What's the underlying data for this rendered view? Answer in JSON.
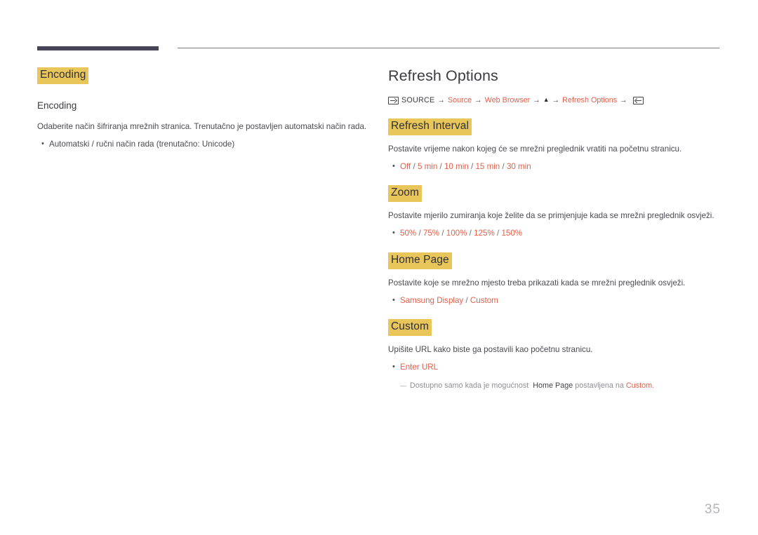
{
  "page": {
    "number": "35"
  },
  "left_column": {
    "section_heading": "Encoding",
    "sub_heading": "Encoding",
    "description": "Odaberite način šifriranja mrežnih stranica. Trenutačno je postavljen automatski način rada.",
    "bullets": [
      {
        "text": "Automatski / ručni način rada (trenutačno: Unicode)"
      }
    ]
  },
  "right_column": {
    "title": "Refresh Options",
    "breadcrumb": {
      "source_icon": "source-input-icon",
      "source_label": "SOURCE",
      "arrow": "→",
      "item1": "Source",
      "item2": "Web Browser",
      "triangle": "▲",
      "item3": "Refresh Options",
      "enter_icon": "enter-key-icon"
    },
    "sections": [
      {
        "heading": "Refresh Interval",
        "description": "Postavite vrijeme nakon kojeg će se mrežni preglednik vratiti na početnu stranicu.",
        "options": [
          "Off",
          "5 min",
          "10 min",
          "15 min",
          "30 min"
        ],
        "separator": "/"
      },
      {
        "heading": "Zoom",
        "description": "Postavite mjerilo zumiranja koje želite da se primjenjuje kada se mrežni preglednik osvježi.",
        "options": [
          "50%",
          "75%",
          "100%",
          "125%",
          "150%"
        ],
        "separator": "/"
      },
      {
        "heading": "Home Page",
        "description": "Postavite koje se mrežno mjesto treba prikazati kada se mrežni preglednik osvježi.",
        "options": [
          "Samsung Display",
          "Custom"
        ],
        "separator": "/"
      },
      {
        "heading": "Custom",
        "description": "Upišite URL kako biste ga postavili kao početnu stranicu.",
        "options": [
          "Enter URL"
        ],
        "separator": "/"
      }
    ],
    "note": {
      "prefix": "Dostupno samo kada je mogućnost",
      "emphasis1": "Home Page",
      "middle": "postavljena na",
      "emphasis2": "Custom",
      "suffix": "."
    }
  },
  "colors": {
    "highlight": "#e9c65a",
    "accent_orange": "#e2604a",
    "rule_dark": "#474458",
    "body_text": "#4a4a51",
    "note_gray": "#8f8f96",
    "page_number": "#b4b4bb"
  }
}
